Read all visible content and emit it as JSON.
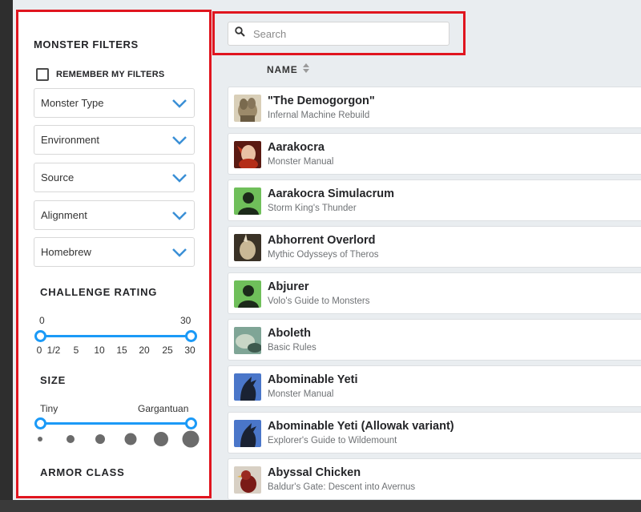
{
  "sidebar": {
    "title": "MONSTER FILTERS",
    "remember_label": "REMEMBER MY FILTERS",
    "dropdowns": [
      {
        "label": "Monster Type"
      },
      {
        "label": "Environment"
      },
      {
        "label": "Source"
      },
      {
        "label": "Alignment"
      },
      {
        "label": "Homebrew"
      }
    ],
    "challenge_rating": {
      "title": "CHALLENGE RATING",
      "min_value": "0",
      "max_value": "30",
      "ticks": [
        "0",
        "1/2",
        "5",
        "10",
        "15",
        "20",
        "25",
        "30"
      ]
    },
    "size": {
      "title": "SIZE",
      "min_value": "Tiny",
      "max_value": "Gargantuan",
      "levels": 6
    },
    "armor_class": {
      "title": "ARMOR CLASS"
    }
  },
  "search": {
    "placeholder": "Search"
  },
  "list_header": {
    "name_label": "NAME"
  },
  "monsters": [
    {
      "name": "\"The Demogorgon\"",
      "source": "Infernal Machine Rebuild",
      "avatar": "demogorgon-art"
    },
    {
      "name": "Aarakocra",
      "source": "Monster Manual",
      "avatar": "aarakocra-art"
    },
    {
      "name": "Aarakocra Simulacrum",
      "source": "Storm King's Thunder",
      "avatar": "humanoid-silhouette"
    },
    {
      "name": "Abhorrent Overlord",
      "source": "Mythic Odysseys of Theros",
      "avatar": "overlord-art"
    },
    {
      "name": "Abjurer",
      "source": "Volo's Guide to Monsters",
      "avatar": "humanoid-silhouette"
    },
    {
      "name": "Aboleth",
      "source": "Basic Rules",
      "avatar": "aboleth-art"
    },
    {
      "name": "Abominable Yeti",
      "source": "Monster Manual",
      "avatar": "monster-silhouette"
    },
    {
      "name": "Abominable Yeti (Allowak variant)",
      "source": "Explorer's Guide to Wildemount",
      "avatar": "monster-silhouette"
    },
    {
      "name": "Abyssal Chicken",
      "source": "Baldur's Gate: Descent into Avernus",
      "avatar": "chicken-art"
    }
  ],
  "colors": {
    "highlight_border": "#e0151f",
    "slider": "#1b9af7",
    "chevron": "#3a8fd6",
    "humanoid_bg": "#6fbf5a",
    "monster_bg": "#4a76c9"
  }
}
